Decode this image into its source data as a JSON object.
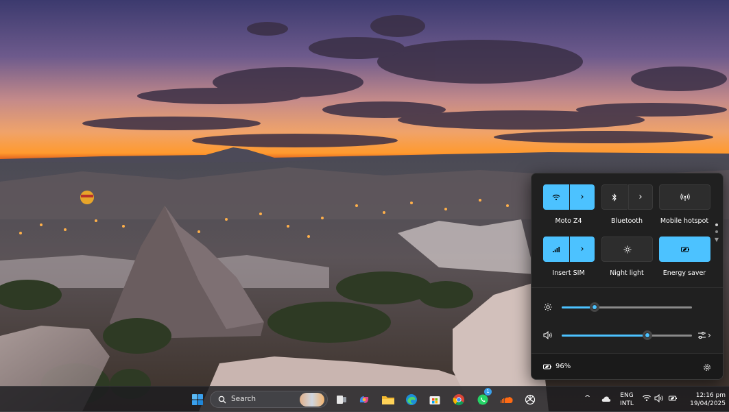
{
  "quick_settings": {
    "tiles": [
      {
        "label": "Moto Z4",
        "icon": "wifi-icon",
        "state": "on",
        "has_arrow": true
      },
      {
        "label": "Bluetooth",
        "icon": "bluetooth-icon",
        "state": "off",
        "has_arrow": true
      },
      {
        "label": "Mobile hotspot",
        "icon": "hotspot-icon",
        "state": "off",
        "has_arrow": false
      },
      {
        "label": "Insert SIM",
        "icon": "cellular-icon",
        "state": "on",
        "has_arrow": true
      },
      {
        "label": "Night light",
        "icon": "night-light-icon",
        "state": "off",
        "has_arrow": false
      },
      {
        "label": "Energy saver",
        "icon": "energy-saver-icon",
        "state": "on",
        "has_arrow": false
      }
    ],
    "brightness_level": 0.25,
    "volume_level": 0.66,
    "battery": {
      "text": "96%"
    }
  },
  "taskbar": {
    "search_placeholder": "Search",
    "apps": [
      "windows-start-icon",
      "search-icon",
      "widgets-icon",
      "task-view-icon",
      "copilot-icon",
      "file-explorer-icon",
      "edge-icon",
      "store-icon",
      "chrome-icon",
      "whatsapp-icon",
      "soundcloud-icon",
      "chatgpt-icon"
    ],
    "whatsapp_badge": "1",
    "tray": {
      "language_line1": "ENG",
      "language_line2": "INTL",
      "time": "12:16 pm",
      "date": "19/04/2025"
    }
  },
  "colors": {
    "accent": "#4cc2ff",
    "panel": "#202020"
  }
}
